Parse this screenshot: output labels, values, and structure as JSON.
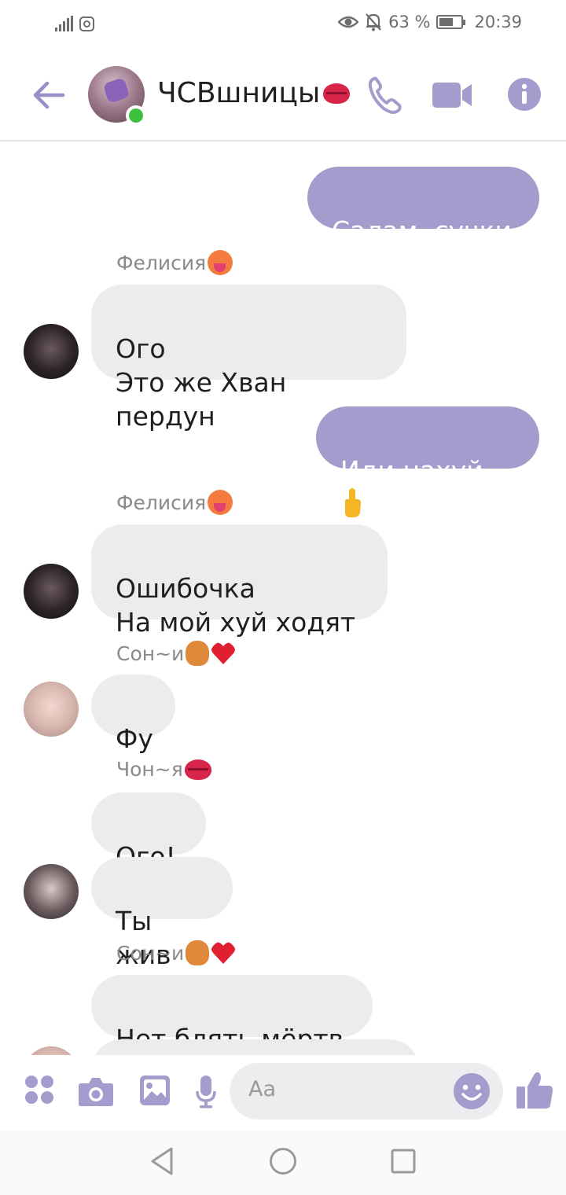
{
  "status_bar": {
    "battery": "63 %",
    "battery_level": 0.63,
    "time": "20:39"
  },
  "header": {
    "title": "ЧСВшницы",
    "title_emoji": "lips-emoji",
    "icons": [
      "back-arrow-icon",
      "phone-icon",
      "video-icon",
      "info-icon"
    ]
  },
  "messages": [
    {
      "side": "out",
      "text": "Салам, сучки"
    },
    {
      "side": "in",
      "sender": "Фелисия",
      "sender_emoji": "hot-face-emoji",
      "text": "Ого\nЭто же Хван пердун"
    },
    {
      "side": "out",
      "text": "Иди нахуй"
    },
    {
      "side": "in",
      "sender": "Фелисия",
      "sender_emoji": "hot-face-emoji",
      "text": "Ошибочка\nНа мой хуй ходят"
    },
    {
      "side": "in",
      "sender": "Сон~и",
      "sender_emoji": "squirrel-heart-emoji",
      "text": "Фу"
    },
    {
      "side": "in",
      "sender": "Чон~я",
      "sender_emoji": "lips-emoji",
      "text": "Ого!"
    },
    {
      "side": "in",
      "text": "Ты жив"
    },
    {
      "side": "in",
      "sender": "Сон~и",
      "sender_emoji": "squirrel-heart-emoji",
      "text": "Нет блять мёртв"
    }
  ],
  "composer": {
    "placeholder": "Aa",
    "icons": [
      "apps-icon",
      "camera-icon",
      "gallery-icon",
      "mic-icon",
      "emoji-icon",
      "like-icon"
    ]
  },
  "accent_color": "#a69bcd",
  "incoming_bubble_color": "#ececef"
}
